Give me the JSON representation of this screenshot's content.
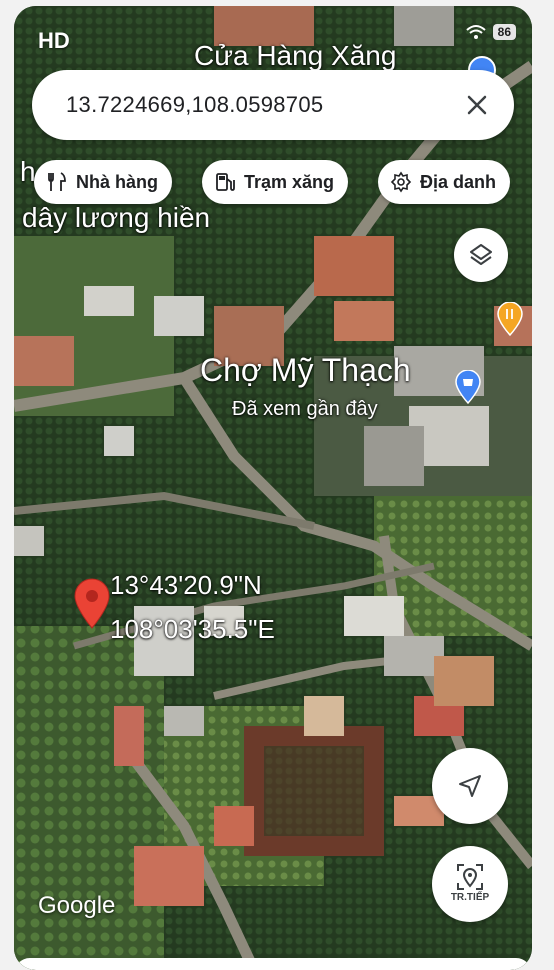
{
  "status_bar": {
    "quality_label": "HD",
    "battery_level": "86"
  },
  "search": {
    "query": "13.7224669,108.0598705",
    "clear_icon": "close-icon"
  },
  "chips": [
    {
      "label": "Nhà hàng",
      "icon": "fork-knife-icon"
    },
    {
      "label": "Trạm xăng",
      "icon": "fuel-pump-icon"
    },
    {
      "label": "Địa danh",
      "icon": "landmark-icon"
    }
  ],
  "map_labels": {
    "gas_station_name": "Cửa Hàng Xăng",
    "overlay_text_1": "h",
    "overlay_text_2": "dây lương hiền",
    "market_name": "Chợ Mỹ Thạch",
    "market_subtitle": "Đã xem gần đây",
    "pin_lat": "13°43'20.9\"N",
    "pin_lng": "108°03'35.5\"E",
    "attribution": "Google"
  },
  "controls": {
    "layers_icon": "layers-icon",
    "locate_icon": "navigation-arrow-icon",
    "next_label": "TR.TIẾP"
  },
  "colors": {
    "pin_red": "#ea4335",
    "market_pin_blue": "#4285f4",
    "restaurant_pin_orange": "#f5a623"
  }
}
